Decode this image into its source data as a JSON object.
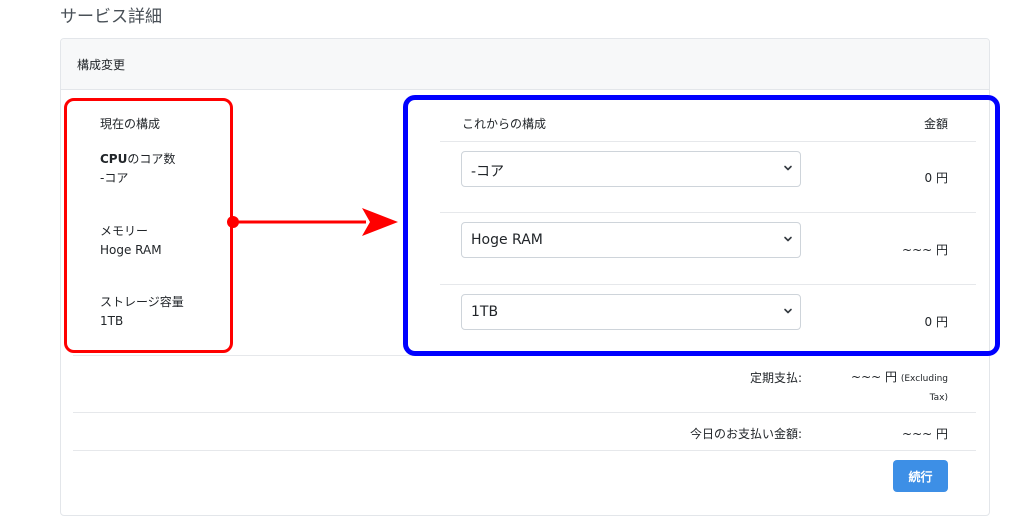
{
  "page_title": "サービス詳細",
  "card_header": "構成変更",
  "current": {
    "header": "現在の構成",
    "items": [
      {
        "name_bold": "CPU",
        "name_rest": "のコア数",
        "value": "-コア"
      },
      {
        "name_bold": "",
        "name_rest": "メモリー",
        "value": "Hoge RAM"
      },
      {
        "name_bold": "",
        "name_rest": "ストレージ容量",
        "value": "1TB"
      }
    ]
  },
  "new_config": {
    "header": "これからの構成",
    "amount_header": "金額",
    "rows": [
      {
        "selected": "-コア",
        "amount": "0 円"
      },
      {
        "selected": "Hoge RAM",
        "amount": "~~~ 円"
      },
      {
        "selected": "1TB",
        "amount": "0 円"
      }
    ]
  },
  "summary": {
    "recurring_label": "定期支払:",
    "recurring_value": "~~~ 円",
    "recurring_note_1": "(Excluding",
    "recurring_note_2": "Tax)",
    "today_label": "今日のお支払い金額:",
    "today_value": "~~~ 円"
  },
  "continue_label": "続行",
  "colors": {
    "annotation_red": "#ff0000",
    "annotation_blue": "#0000ff",
    "button_blue": "#3d8fe6"
  },
  "icons": {
    "select_chevron": "chevron-down-icon",
    "annotation_arrow": "arrow-right-icon"
  }
}
